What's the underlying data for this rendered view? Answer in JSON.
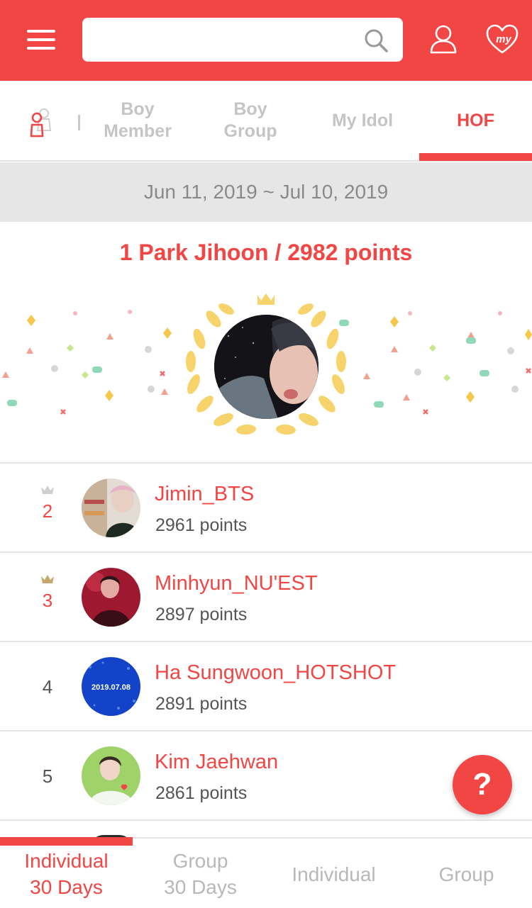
{
  "header": {
    "menu_icon": "hamburger-menu-icon",
    "search": {
      "value": "",
      "placeholder": "",
      "icon": "search-icon"
    },
    "user_icon": "user-icon",
    "myidol_icon": "heart-my-icon",
    "myidol_label": "my"
  },
  "tabs": {
    "gender_icon": "gender-toggle-icon",
    "items": [
      {
        "label": "Boy\nMember",
        "active": false
      },
      {
        "label": "Boy\nGroup",
        "active": false
      },
      {
        "label": "My Idol",
        "active": false
      },
      {
        "label": "HOF",
        "active": true
      }
    ]
  },
  "period": "Jun 11, 2019 ~ Jul 10, 2019",
  "winner": {
    "title": "1  Park Jihoon / 2982 points",
    "rank": 1,
    "name": "Park Jihoon",
    "points": 2982
  },
  "ranking": [
    {
      "rank": "2",
      "name": "Jimin_BTS",
      "points": "2961 points",
      "crown": true
    },
    {
      "rank": "3",
      "name": "Minhyun_NU'EST",
      "points": "2897 points",
      "crown": true
    },
    {
      "rank": "4",
      "name": "Ha Sungwoon_HOTSHOT",
      "points": "2891 points",
      "crown": false,
      "avatar_text": "2019.07.08"
    },
    {
      "rank": "5",
      "name": "Kim Jaehwan",
      "points": "2861 points",
      "crown": false
    }
  ],
  "help": {
    "label": "?",
    "icon": "question-icon"
  },
  "bottom_tabs": [
    {
      "label": "Individual\n30 Days",
      "active": true
    },
    {
      "label": "Group\n30 Days",
      "active": false
    },
    {
      "label": "Individual",
      "active": false
    },
    {
      "label": "Group",
      "active": false
    }
  ],
  "colors": {
    "accent": "#f24645",
    "inactive": "#c5c5c5",
    "gold": "#f7d46b"
  }
}
